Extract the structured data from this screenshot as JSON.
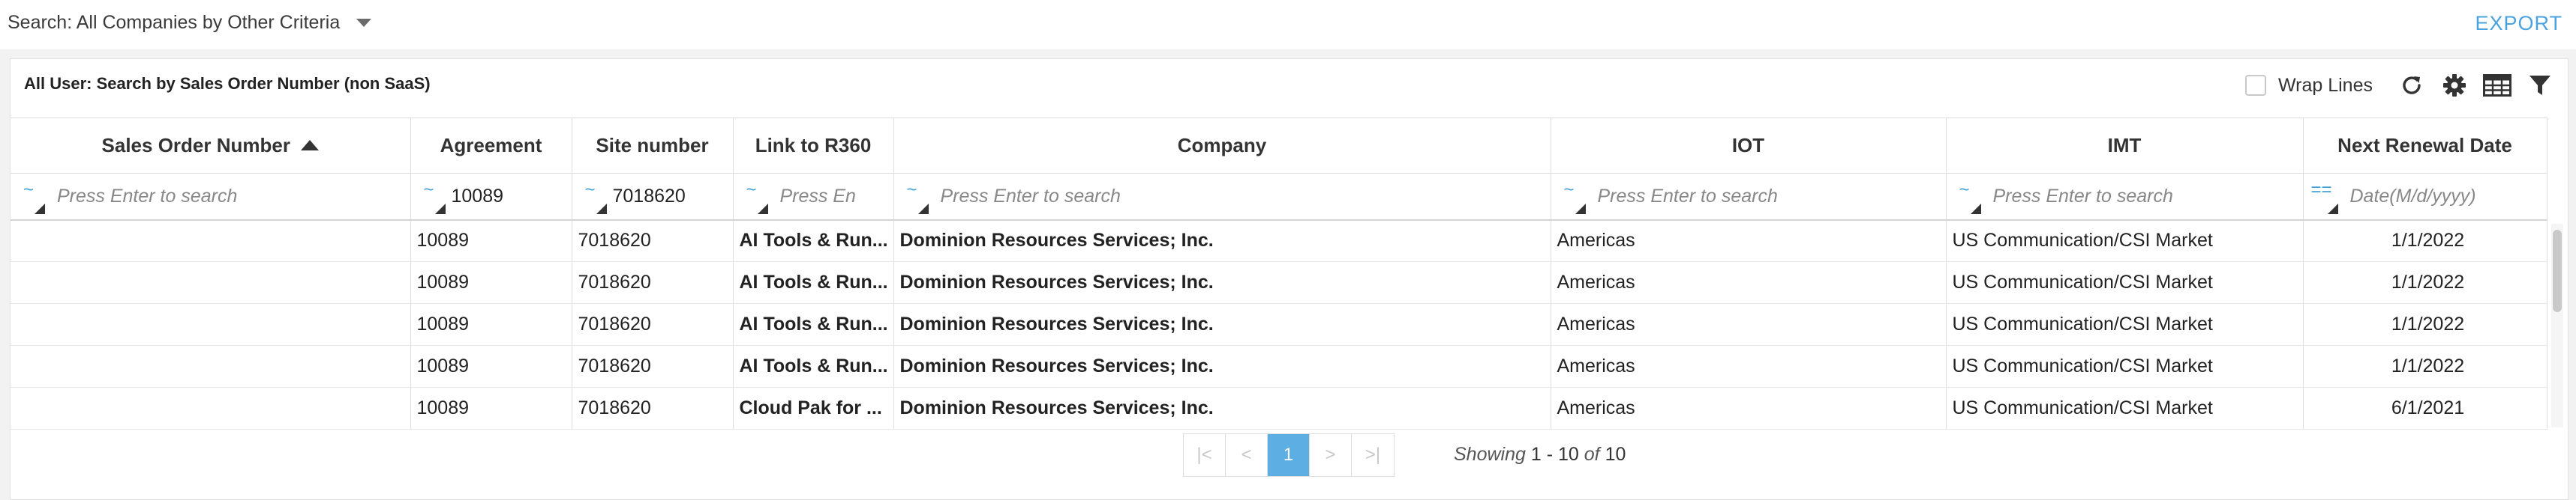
{
  "search": {
    "label": "Search: All Companies by Other Criteria"
  },
  "export": {
    "label": "EXPORT"
  },
  "panel": {
    "title": "All User: Search by Sales Order Number (non SaaS)",
    "wrap_lines_label": "Wrap Lines",
    "wrap_lines_checked": false
  },
  "columns": [
    {
      "key": "sales_order",
      "label": "Sales Order Number",
      "sorted": "asc"
    },
    {
      "key": "agreement",
      "label": "Agreement"
    },
    {
      "key": "site",
      "label": "Site number"
    },
    {
      "key": "link",
      "label": "Link to R360"
    },
    {
      "key": "company",
      "label": "Company"
    },
    {
      "key": "iot",
      "label": "IOT"
    },
    {
      "key": "imt",
      "label": "IMT"
    },
    {
      "key": "renewal",
      "label": "Next Renewal Date"
    }
  ],
  "filters": {
    "sales_order": {
      "op": "~",
      "value": "",
      "placeholder": "Press Enter to search"
    },
    "agreement": {
      "op": "~",
      "value": "10089",
      "placeholder": ""
    },
    "site": {
      "op": "~",
      "value": "7018620",
      "placeholder": ""
    },
    "link": {
      "op": "~",
      "value": "",
      "placeholder": "Press En"
    },
    "company": {
      "op": "~",
      "value": "",
      "placeholder": "Press Enter to search"
    },
    "iot": {
      "op": "~",
      "value": "",
      "placeholder": "Press Enter to search"
    },
    "imt": {
      "op": "~",
      "value": "",
      "placeholder": "Press Enter to search"
    },
    "renewal": {
      "op": "==",
      "value": "",
      "placeholder": "Date(M/d/yyyy)"
    }
  },
  "rows": [
    {
      "sales_order": "",
      "agreement": "10089",
      "site": "7018620",
      "link": "AI Tools & Run...",
      "company": "Dominion Resources Services; Inc.",
      "iot": "Americas",
      "imt": "US Communication/CSI Market",
      "renewal": "1/1/2022"
    },
    {
      "sales_order": "",
      "agreement": "10089",
      "site": "7018620",
      "link": "AI Tools & Run...",
      "company": "Dominion Resources Services; Inc.",
      "iot": "Americas",
      "imt": "US Communication/CSI Market",
      "renewal": "1/1/2022"
    },
    {
      "sales_order": "",
      "agreement": "10089",
      "site": "7018620",
      "link": "AI Tools & Run...",
      "company": "Dominion Resources Services; Inc.",
      "iot": "Americas",
      "imt": "US Communication/CSI Market",
      "renewal": "1/1/2022"
    },
    {
      "sales_order": "",
      "agreement": "10089",
      "site": "7018620",
      "link": "AI Tools & Run...",
      "company": "Dominion Resources Services; Inc.",
      "iot": "Americas",
      "imt": "US Communication/CSI Market",
      "renewal": "1/1/2022"
    },
    {
      "sales_order": "",
      "agreement": "10089",
      "site": "7018620",
      "link": "Cloud Pak for ...",
      "company": "Dominion Resources Services; Inc.",
      "iot": "Americas",
      "imt": "US Communication/CSI Market",
      "renewal": "6/1/2021"
    }
  ],
  "pagination": {
    "first": "|<",
    "prev": "<",
    "current": "1",
    "next": ">",
    "last": ">|",
    "showing_prefix": "Showing",
    "range": "1 - 10",
    "of_label": "of",
    "total": "10"
  },
  "icons": {
    "refresh": "refresh-icon",
    "settings": "gear-icon",
    "columns": "table-columns-icon",
    "filter": "filter-icon"
  },
  "colors": {
    "accent": "#4aa3df",
    "link": "#3d87b8",
    "active_page": "#5daee3"
  }
}
